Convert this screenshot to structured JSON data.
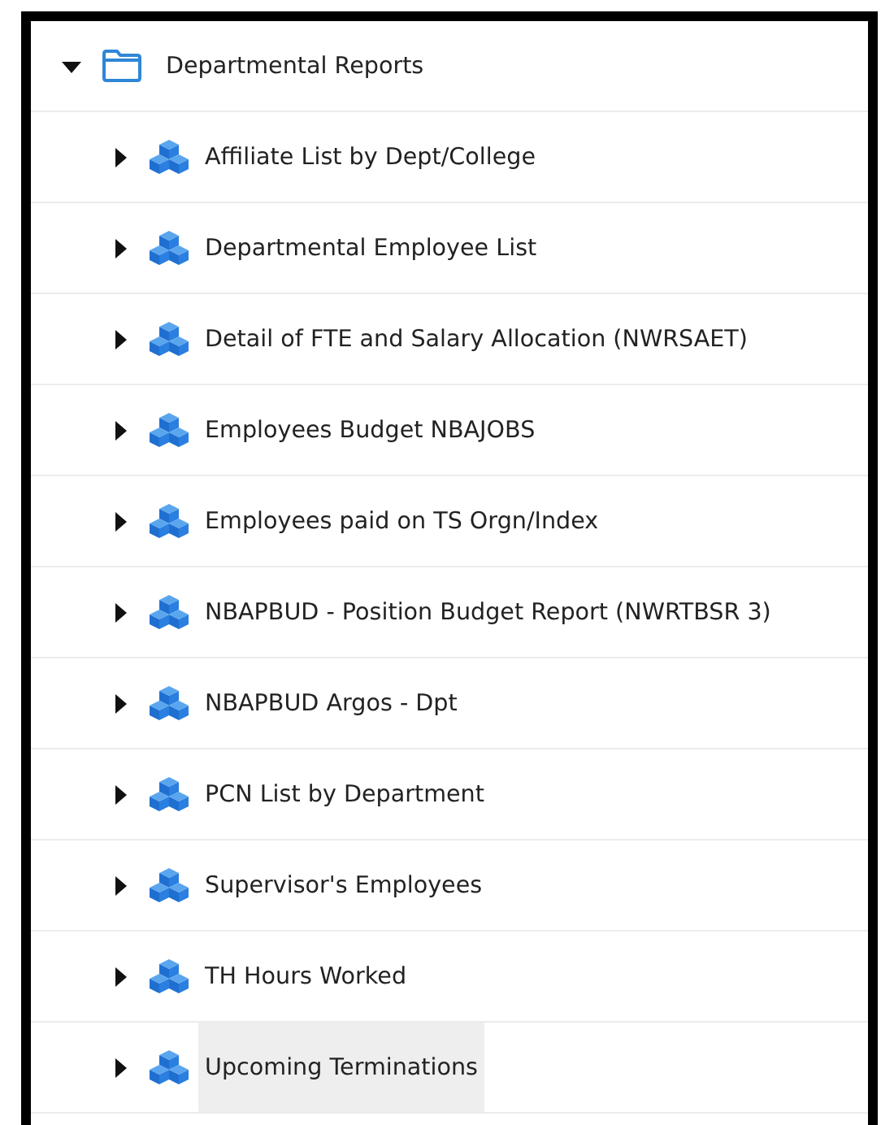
{
  "tree": {
    "label": "Departmental Reports",
    "expanded": true,
    "children": [
      {
        "label": "Affiliate List by Dept/College",
        "expanded": false,
        "selected": false
      },
      {
        "label": "Departmental Employee List",
        "expanded": false,
        "selected": false
      },
      {
        "label": "Detail of FTE and Salary Allocation (NWRSAET)",
        "expanded": false,
        "selected": false
      },
      {
        "label": "Employees Budget NBAJOBS",
        "expanded": false,
        "selected": false
      },
      {
        "label": "Employees paid on TS Orgn/Index",
        "expanded": false,
        "selected": false
      },
      {
        "label": "NBAPBUD - Position Budget Report (NWRTBSR 3)",
        "expanded": false,
        "selected": false
      },
      {
        "label": "NBAPBUD Argos - Dpt",
        "expanded": false,
        "selected": false
      },
      {
        "label": "PCN List by Department",
        "expanded": false,
        "selected": false
      },
      {
        "label": "Supervisor's Employees",
        "expanded": false,
        "selected": false
      },
      {
        "label": "TH Hours Worked",
        "expanded": false,
        "selected": false
      },
      {
        "label": "Upcoming Terminations",
        "expanded": false,
        "selected": true
      }
    ]
  }
}
